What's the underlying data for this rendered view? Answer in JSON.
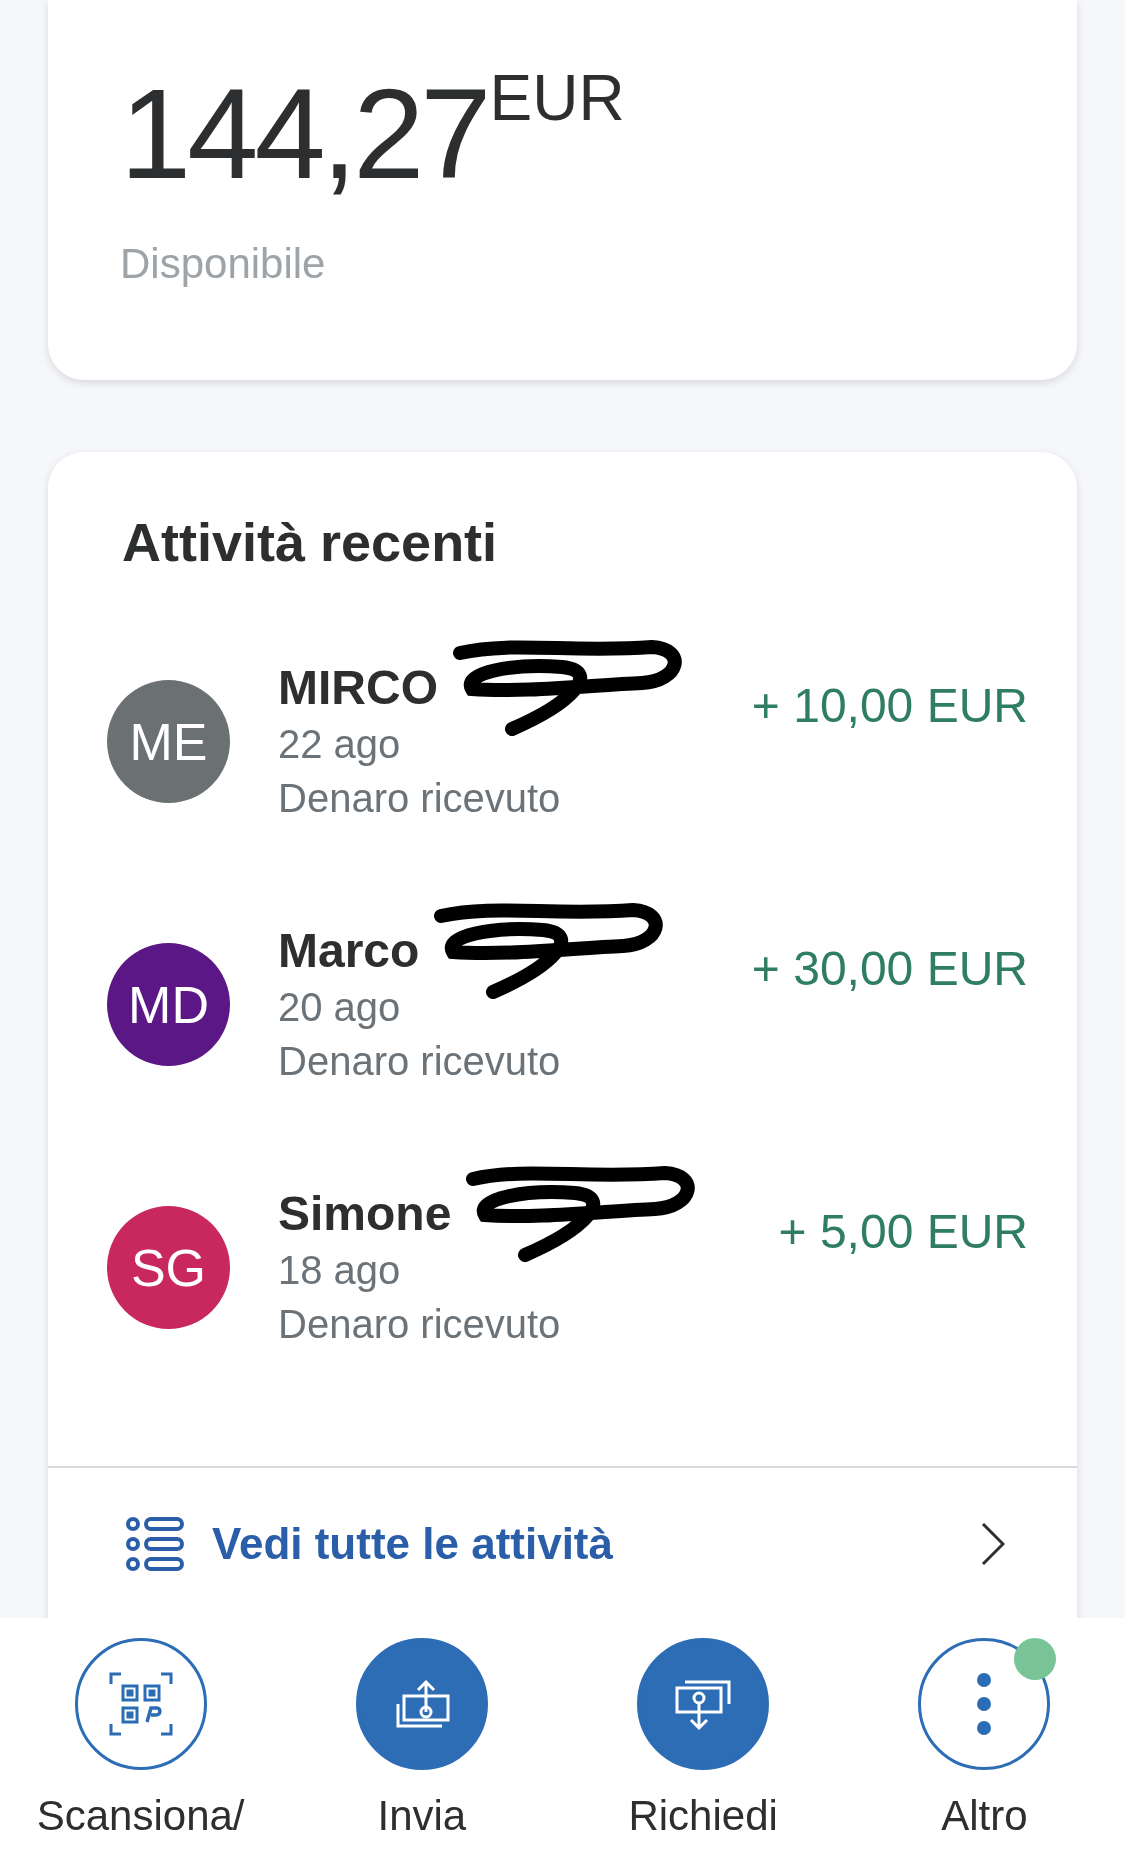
{
  "balance": {
    "amount": "144,27",
    "currency": "EUR",
    "caption": "Disponibile"
  },
  "activity": {
    "title": "Attività recenti",
    "items": [
      {
        "initials": "ME",
        "color": "#6b7073",
        "name": "MIRCO",
        "redacted": true,
        "date": "22 ago",
        "type": "Denaro ricevuto",
        "amount": "+ 10,00 EUR"
      },
      {
        "initials": "MD",
        "color": "#5b1786",
        "name": "Marco",
        "redacted": true,
        "date": "20 ago",
        "type": "Denaro ricevuto",
        "amount": "+ 30,00 EUR"
      },
      {
        "initials": "SG",
        "color": "#c9285f",
        "name": "Simone",
        "redacted": true,
        "date": "18 ago",
        "type": "Denaro ricevuto",
        "amount": "+ 5,00 EUR"
      }
    ],
    "see_all": "Vedi tutte le attività"
  },
  "bottom_nav": [
    {
      "kind": "scan",
      "label": "Scansiona/",
      "filled": false,
      "notification": false
    },
    {
      "kind": "send",
      "label": "Invia",
      "filled": true,
      "notification": false
    },
    {
      "kind": "request",
      "label": "Richiedi",
      "filled": true,
      "notification": false
    },
    {
      "kind": "more",
      "label": "Altro",
      "filled": false,
      "notification": true
    }
  ]
}
